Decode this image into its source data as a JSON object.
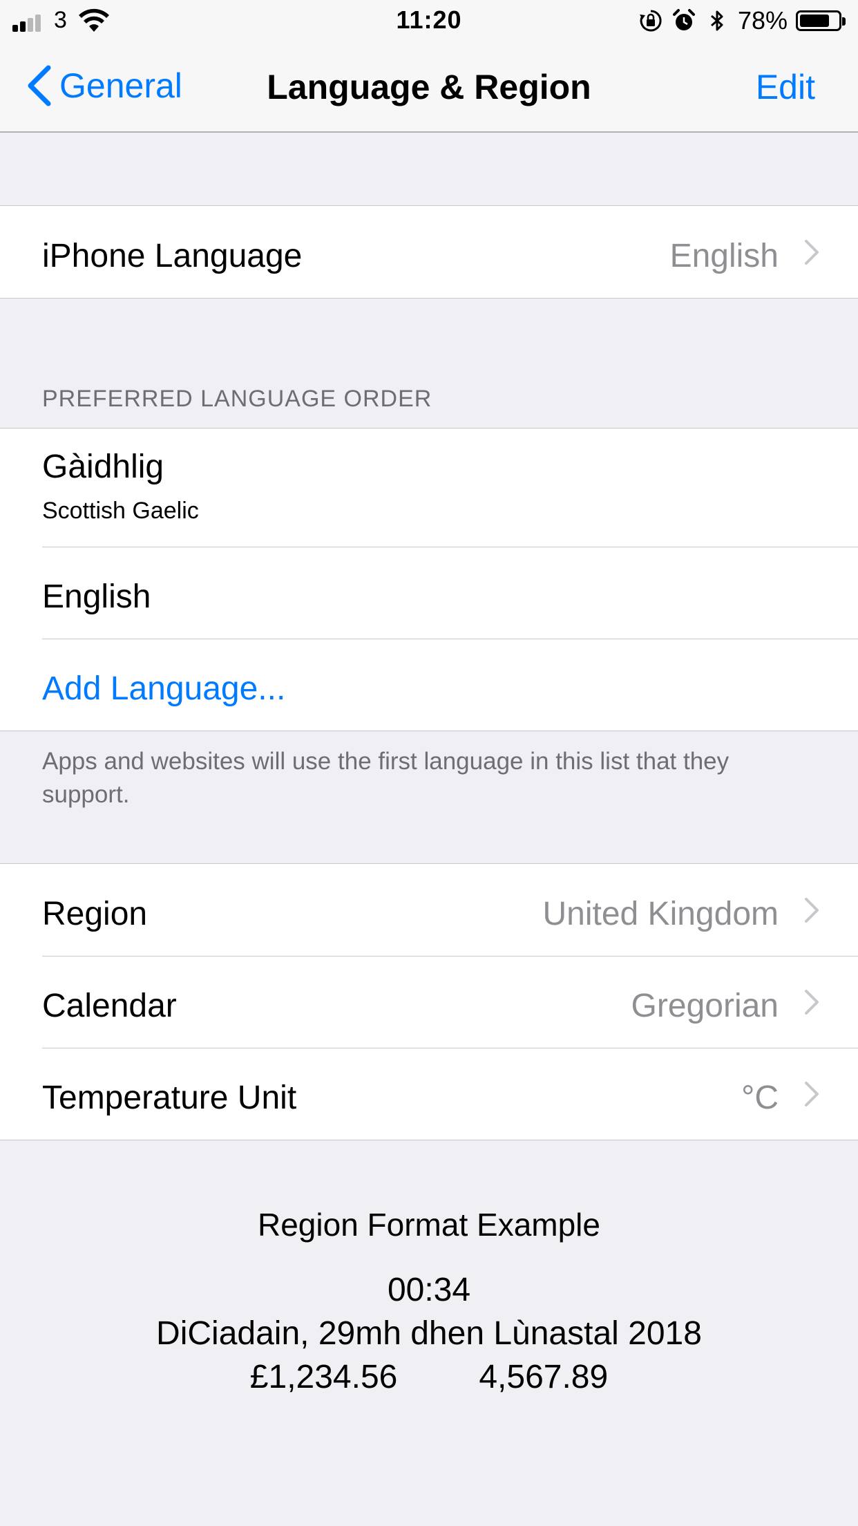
{
  "status_bar": {
    "carrier": "3",
    "time": "11:20",
    "battery_percent": "78%",
    "battery_level": 0.78,
    "signal_bars_active": 2,
    "icons": [
      "signal-icon",
      "wifi-icon",
      "orientation-lock-icon",
      "alarm-icon",
      "bluetooth-icon",
      "battery-icon"
    ]
  },
  "nav": {
    "back_label": "General",
    "title": "Language & Region",
    "edit_label": "Edit"
  },
  "iphone_language": {
    "label": "iPhone Language",
    "value": "English"
  },
  "preferred": {
    "header": "PREFERRED LANGUAGE ORDER",
    "languages": [
      {
        "name": "Gàidhlig",
        "subtitle": "Scottish Gaelic"
      },
      {
        "name": "English"
      }
    ],
    "add_label": "Add Language...",
    "footer": "Apps and websites will use the first language in this list that they support."
  },
  "region_settings": [
    {
      "label": "Region",
      "value": "United Kingdom"
    },
    {
      "label": "Calendar",
      "value": "Gregorian"
    },
    {
      "label": "Temperature Unit",
      "value": "°C"
    }
  ],
  "format_example": {
    "title": "Region Format Example",
    "time": "00:34",
    "date": "DiCiadain, 29mh dhen Lùnastal 2018",
    "currency": "£1,234.56",
    "number": "4,567.89"
  },
  "colors": {
    "accent": "#007aff",
    "background": "#efeff4",
    "secondary_text": "#8e8e93",
    "separator": "#c8c7cc"
  }
}
